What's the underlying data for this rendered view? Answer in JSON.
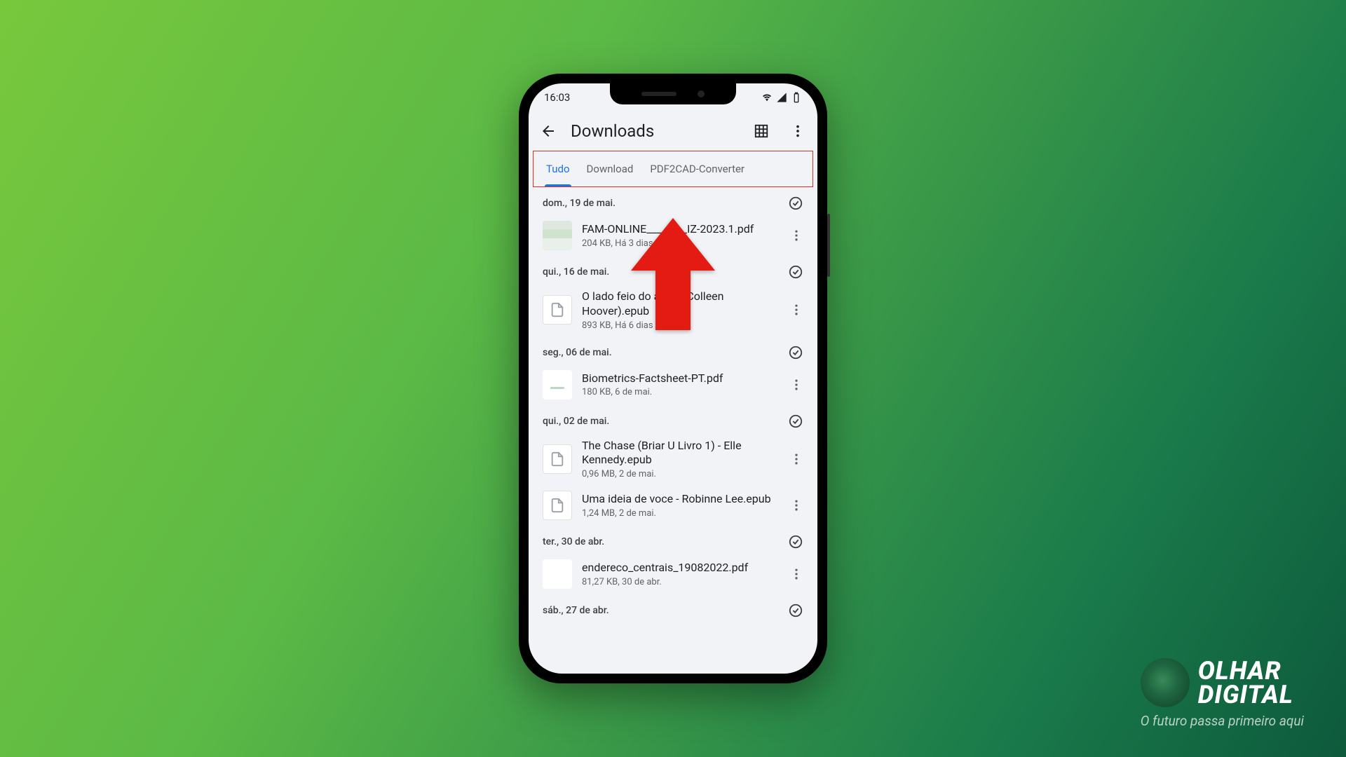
{
  "status": {
    "time": "16:03"
  },
  "appbar": {
    "title": "Downloads"
  },
  "tabs": [
    {
      "label": "Tudo",
      "active": true
    },
    {
      "label": "Download",
      "active": false
    },
    {
      "label": "PDF2CAD-Converter",
      "active": false
    }
  ],
  "groups": [
    {
      "date": "dom., 19 de mai.",
      "files": [
        {
          "name": "FAM-ONLINE________IZ-2023.1.pdf",
          "meta": "204 KB, Há 3 dias",
          "thumb": "pdf1"
        }
      ]
    },
    {
      "date": "qui., 16 de mai.",
      "files": [
        {
          "name": "O lado feio do amor (Colleen Hoover).epub",
          "meta": "893 KB, Há 6 dias",
          "thumb": "file"
        }
      ]
    },
    {
      "date": "seg., 06 de mai.",
      "files": [
        {
          "name": "Biometrics-Factsheet-PT.pdf",
          "meta": "180 KB, 6 de mai.",
          "thumb": "pdf2"
        }
      ]
    },
    {
      "date": "qui., 02 de mai.",
      "files": [
        {
          "name": "The Chase (Briar U Livro 1) - Elle Kennedy.epub",
          "meta": "0,96 MB, 2 de mai.",
          "thumb": "file"
        },
        {
          "name": "Uma ideia de voce - Robinne Lee.epub",
          "meta": "1,24 MB, 2 de mai.",
          "thumb": "file"
        }
      ]
    },
    {
      "date": "ter., 30 de abr.",
      "files": [
        {
          "name": "endereco_centrais_19082022.pdf",
          "meta": "81,27 KB, 30 de abr.",
          "thumb": "pdf3"
        }
      ]
    },
    {
      "date": "sáb., 27 de abr.",
      "files": []
    }
  ],
  "logo": {
    "l1": "OLHAR",
    "l2": "DIGITAL",
    "tag": "O futuro passa primeiro aqui"
  }
}
